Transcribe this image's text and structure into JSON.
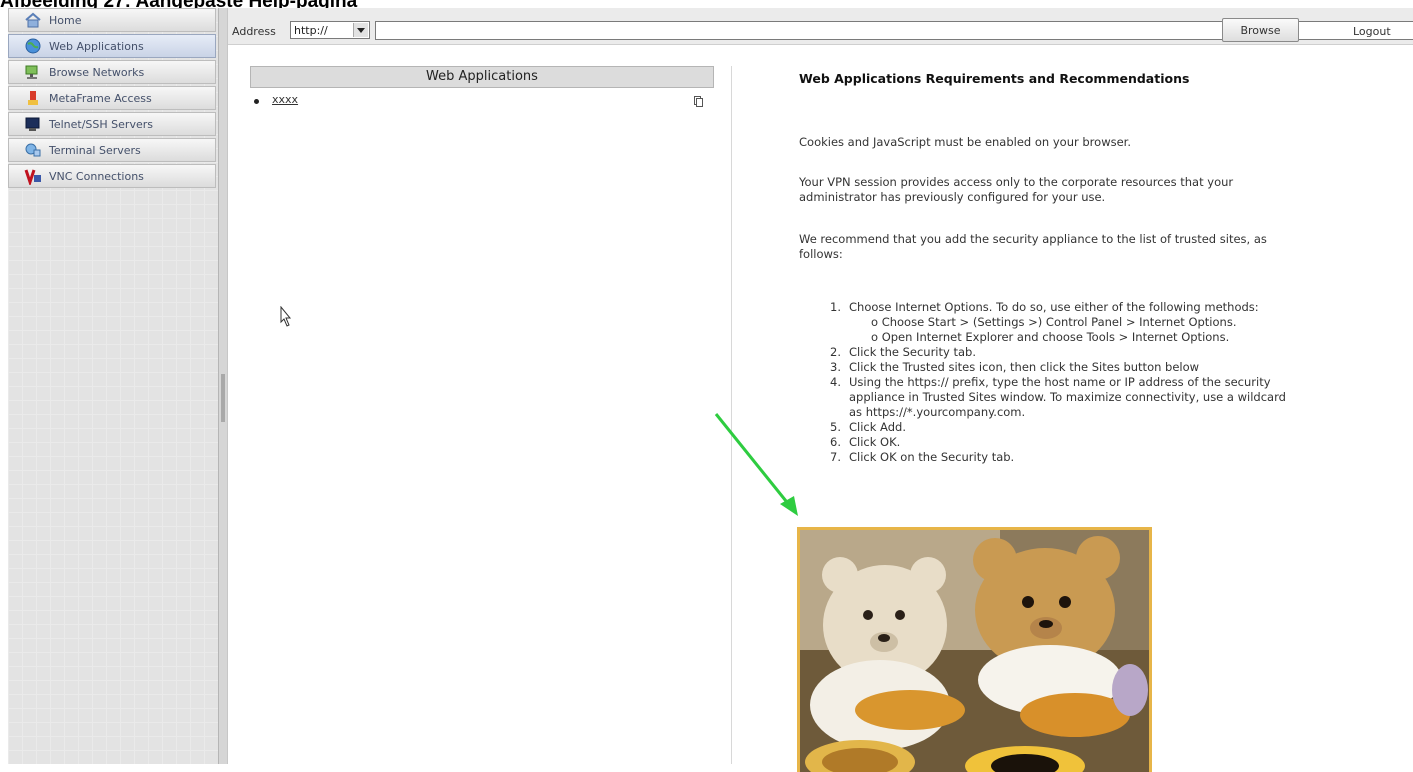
{
  "caption": "Afbeelding 27: Aangepaste Help-pagina",
  "sidebar": {
    "items": [
      {
        "label": "Home",
        "icon": "home-icon"
      },
      {
        "label": "Web Applications",
        "icon": "globe-icon",
        "active": true
      },
      {
        "label": "Browse Networks",
        "icon": "network-icon"
      },
      {
        "label": "MetaFrame Access",
        "icon": "metaframe-icon"
      },
      {
        "label": "Telnet/SSH Servers",
        "icon": "terminal-icon"
      },
      {
        "label": "Terminal Servers",
        "icon": "terminal-server-icon"
      },
      {
        "label": "VNC Connections",
        "icon": "vnc-icon"
      }
    ]
  },
  "toolbar": {
    "address_label": "Address",
    "protocol_value": "http://",
    "url_value": "",
    "browse_label": "Browse",
    "logout_label": "Logout"
  },
  "left_panel": {
    "header": "Web Applications",
    "items": [
      {
        "label": "xxxx"
      }
    ]
  },
  "help": {
    "title": "Web Applications Requirements and Recommendations",
    "p1": "Cookies and JavaScript must be enabled on your browser.",
    "p2_line1": "Your VPN session provides access only to the corporate resources that your",
    "p2_line2": "administrator has previously configured for your use.",
    "p3_line1": "We recommend that you add the security appliance to the list of trusted sites, as",
    "p3_line2": "follows:",
    "steps": [
      {
        "num": "1.",
        "text": "Choose Internet Options. To do so, use either of the following methods:"
      },
      {
        "num": "2.",
        "text": "Click the Security tab."
      },
      {
        "num": "3.",
        "text": "Click the Trusted sites icon, then click the Sites button below"
      },
      {
        "num": "4.",
        "text": "Using the https:// prefix, type the host name or IP address of the security"
      },
      {
        "num": "5.",
        "text": "Click Add."
      },
      {
        "num": "6.",
        "text": "Click OK."
      },
      {
        "num": "7.",
        "text": "Click OK on the Security tab."
      }
    ],
    "sub1": "o  Choose Start > (Settings >) Control Panel > Internet Options.",
    "sub2": "o  Open Internet Explorer and choose Tools > Internet Options.",
    "step4_cont1": "appliance in Trusted Sites window. To maximize connectivity, use a wildcard",
    "step4_cont2": "as https://*.yourcompany.com."
  },
  "colors": {
    "arrow": "#2ecc40",
    "image_border": "#e7b548"
  }
}
